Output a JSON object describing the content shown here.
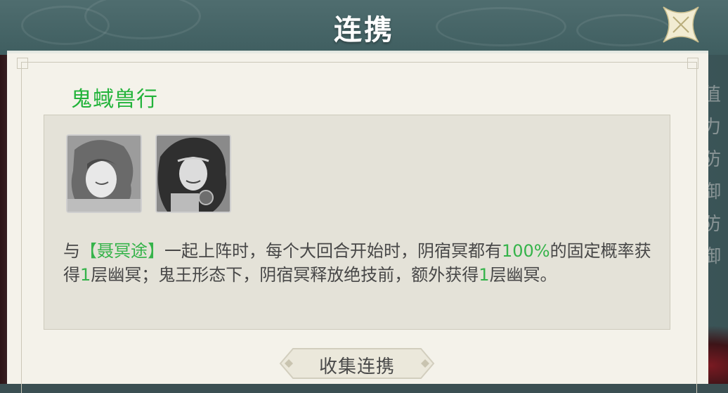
{
  "header": {
    "title": "连携"
  },
  "background": {
    "right_text": [
      "值",
      "力",
      "防御",
      "防御"
    ]
  },
  "section": {
    "title": "鬼蜮兽行"
  },
  "description": {
    "p1": "与",
    "hero": "【聂冥途】",
    "p2": "一起上阵时，每个大回合开始时，阴宿冥都有",
    "pct": "100%",
    "p3": "的固定概率获得",
    "n1": "1",
    "p4": "层幽冥；鬼王形态下，阴宿冥释放绝技前，额外获得",
    "n2": "1",
    "p5": "层幽冥。"
  },
  "buttons": {
    "collect": "收集连携"
  },
  "icons": {
    "close": "close-x-icon",
    "portrait_1": "hero-portrait-1",
    "portrait_2": "hero-portrait-2"
  },
  "colors": {
    "accent_green": "#35b34a",
    "title_green": "#22b33a",
    "header": "#466466",
    "panel": "#f4f2ea"
  }
}
